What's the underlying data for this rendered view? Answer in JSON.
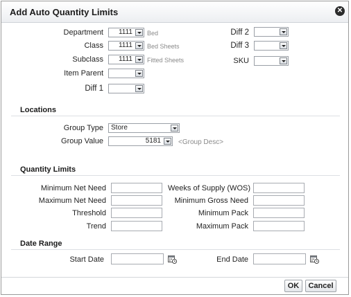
{
  "dialog": {
    "title": "Add Auto Quantity Limits",
    "close_icon": "close-icon"
  },
  "merch": {
    "department": {
      "label": "Department",
      "value": "1111",
      "desc": "Bed"
    },
    "class": {
      "label": "Class",
      "value": "1111",
      "desc": "Bed Sheets"
    },
    "subclass": {
      "label": "Subclass",
      "value": "1111",
      "desc": "Fitted Sheets"
    },
    "item_parent": {
      "label": "Item Parent",
      "value": ""
    },
    "diff1": {
      "label": "Diff 1",
      "value": ""
    },
    "diff2": {
      "label": "Diff 2",
      "value": ""
    },
    "diff3": {
      "label": "Diff 3",
      "value": ""
    },
    "sku": {
      "label": "SKU",
      "value": ""
    }
  },
  "locations": {
    "heading": "Locations",
    "group_type": {
      "label": "Group Type",
      "value": "Store"
    },
    "group_value": {
      "label": "Group Value",
      "value": "5181",
      "desc": "<Group Desc>"
    }
  },
  "quantity_limits": {
    "heading": "Quantity Limits",
    "min_net_need": {
      "label": "Minimum Net Need",
      "value": ""
    },
    "max_net_need": {
      "label": "Maximum Net Need",
      "value": ""
    },
    "threshold": {
      "label": "Threshold",
      "value": ""
    },
    "trend": {
      "label": "Trend",
      "value": ""
    },
    "wos": {
      "label": "Weeks of Supply (WOS)",
      "value": ""
    },
    "min_gross_need": {
      "label": "Minimum Gross Need",
      "value": ""
    },
    "min_pack": {
      "label": "Minimum Pack",
      "value": ""
    },
    "max_pack": {
      "label": "Maximum Pack",
      "value": ""
    }
  },
  "date_range": {
    "heading": "Date Range",
    "start_date": {
      "label": "Start Date",
      "value": ""
    },
    "end_date": {
      "label": "End Date",
      "value": ""
    },
    "calendar_icon": "calendar-icon"
  },
  "footer": {
    "ok_label": "OK",
    "cancel_label": "Cancel"
  }
}
